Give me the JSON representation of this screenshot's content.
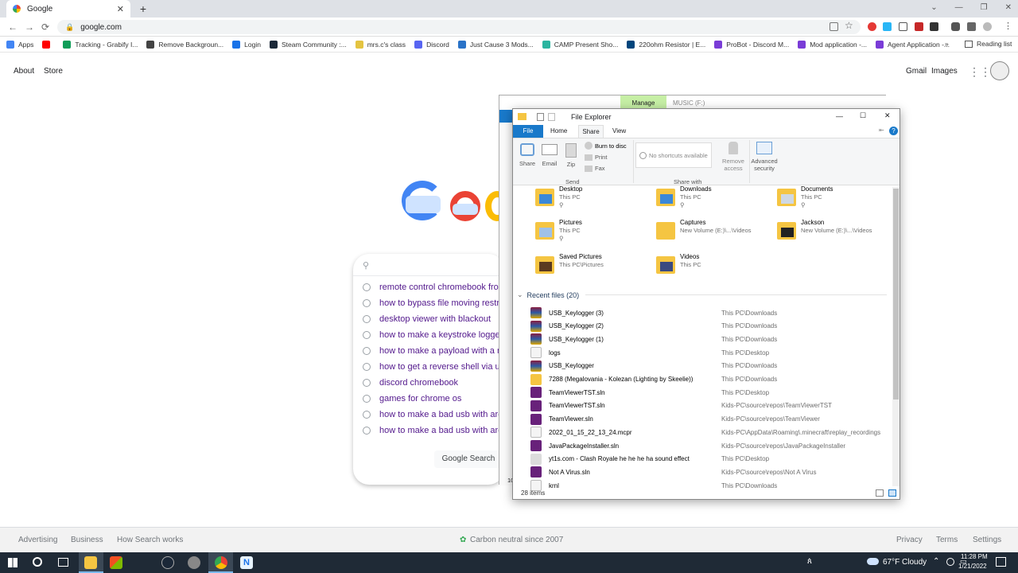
{
  "browser": {
    "tab_title": "Google",
    "tab_close": "✕",
    "new_tab": "+",
    "url": "google.com",
    "window_buttons": [
      "⌄",
      "—",
      "❐",
      "✕"
    ],
    "back": "←",
    "forward": "→",
    "reload": "⟳",
    "reading_list": "Reading list",
    "bookmarks": [
      {
        "label": "Apps",
        "color": "#4285f4"
      },
      {
        "label": "",
        "color": "#ff0000"
      },
      {
        "label": "Tracking - Grabify I...",
        "color": "#0f9d58"
      },
      {
        "label": "Remove Backgroun...",
        "color": "#444444"
      },
      {
        "label": "Login",
        "color": "#1a73e8"
      },
      {
        "label": "Steam Community :...",
        "color": "#1b2838"
      },
      {
        "label": "mrs.c's class",
        "color": "#e4c441"
      },
      {
        "label": "Discord",
        "color": "#5865f2"
      },
      {
        "label": "Just Cause 3 Mods...",
        "color": "#2a73c8"
      },
      {
        "label": "CAMP Present Sho...",
        "color": "#2bb5a0"
      },
      {
        "label": "220ohm Resistor | E...",
        "color": "#00457c"
      },
      {
        "label": "ProBot - Discord M...",
        "color": "#7a3cd7"
      },
      {
        "label": "Mod application -...",
        "color": "#7a3cd7"
      },
      {
        "label": "Agent Application -...",
        "color": "#7a3cd7"
      }
    ],
    "more_bookmarks": "»"
  },
  "google": {
    "header_links": {
      "about": "About",
      "store": "Store",
      "gmail": "Gmail",
      "images": "Images"
    },
    "suggestions": [
      "remote control chromebook from",
      "how to bypass file moving restric",
      "desktop viewer with blackout",
      "how to make a keystroke logger",
      "how to make a payload with a n",
      "how to get a reverse shell via us",
      "discord chromebook",
      "games for chrome os",
      "how to make a bad usb with ard",
      "how to make a bad usb with ard"
    ],
    "search_button": "Google Search",
    "footer": {
      "advertising": "Advertising",
      "business": "Business",
      "how_search_works": "How Search works",
      "carbon": "Carbon neutral since 2007",
      "privacy": "Privacy",
      "terms": "Terms",
      "settings": "Settings"
    }
  },
  "bg_explorer": {
    "manage_tab": "Manage",
    "title": "MUSIC (F:)",
    "items_partial": "10"
  },
  "explorer": {
    "title": "File Explorer",
    "tabs": {
      "file": "File",
      "home": "Home",
      "share": "Share",
      "view": "View"
    },
    "window_buttons": {
      "min": "—",
      "max": "☐",
      "close": "✕"
    },
    "ribbon": {
      "share": "Share",
      "email": "Email",
      "zip": "Zip",
      "burn": "Burn to disc",
      "print": "Print",
      "fax": "Fax",
      "send_group": "Send",
      "no_shortcuts": "No shortcuts available",
      "share_with_group": "Share with",
      "remove_access": "Remove access",
      "advanced_security": "Advanced security"
    },
    "quick_access": [
      {
        "name": "Desktop",
        "sub": "This PC",
        "pinned": true
      },
      {
        "name": "Downloads",
        "sub": "This PC",
        "pinned": true
      },
      {
        "name": "Documents",
        "sub": "This PC",
        "pinned": true
      },
      {
        "name": "Pictures",
        "sub": "This PC",
        "pinned": true
      },
      {
        "name": "Captures",
        "sub": "New Volume (E:)\\...\\Videos",
        "pinned": false
      },
      {
        "name": "Jackson",
        "sub": "New Volume (E:)\\...\\Videos",
        "pinned": false
      },
      {
        "name": "Saved Pictures",
        "sub": "This PC\\Pictures",
        "pinned": false
      },
      {
        "name": "Videos",
        "sub": "This PC",
        "pinned": false
      }
    ],
    "recent_header": "Recent files (20)",
    "recent_files": [
      {
        "name": "USB_Keylogger (3)",
        "location": "This PC\\Downloads",
        "icon": "rar"
      },
      {
        "name": "USB_Keylogger (2)",
        "location": "This PC\\Downloads",
        "icon": "rar"
      },
      {
        "name": "USB_Keylogger (1)",
        "location": "This PC\\Downloads",
        "icon": "rar"
      },
      {
        "name": "logs",
        "location": "This PC\\Desktop",
        "icon": "file"
      },
      {
        "name": "USB_Keylogger",
        "location": "This PC\\Downloads",
        "icon": "rar"
      },
      {
        "name": "7288 (Megalovania - Kolezan (Lighting by Skeelie))",
        "location": "This PC\\Downloads",
        "icon": "zip"
      },
      {
        "name": "TeamViewerTST.sln",
        "location": "This PC\\Desktop",
        "icon": "vs"
      },
      {
        "name": "TeamViewerTST.sln",
        "location": "Kids-PC\\source\\repos\\TeamViewerTST",
        "icon": "vs"
      },
      {
        "name": "TeamViewer.sln",
        "location": "Kids-PC\\source\\repos\\TeamViewer",
        "icon": "vs"
      },
      {
        "name": "2022_01_15_22_13_24.mcpr",
        "location": "Kids-PC\\AppData\\Roaming\\.minecraft\\replay_recordings",
        "icon": "file"
      },
      {
        "name": "JavaPackageInstaller.sln",
        "location": "Kids-PC\\source\\repos\\JavaPackageInstaller",
        "icon": "vs"
      },
      {
        "name": "yt1s.com - Clash Royale he he he ha sound effect",
        "location": "This PC\\Desktop",
        "icon": "media"
      },
      {
        "name": "Not A Virus.sln",
        "location": "Kids-PC\\source\\repos\\Not A Virus",
        "icon": "vs"
      },
      {
        "name": "krnl",
        "location": "This PC\\Downloads",
        "icon": "file"
      }
    ],
    "status": "28 items"
  },
  "taskbar": {
    "weather": "67°F  Cloudy",
    "time": "11:28 PM",
    "date": "1/21/2022"
  }
}
